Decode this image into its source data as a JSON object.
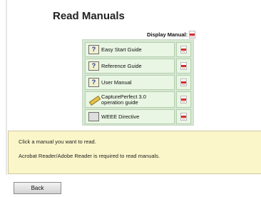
{
  "page": {
    "title": "Read Manuals"
  },
  "display_manual": {
    "label": "Display Manual:",
    "icon": "pdf-icon"
  },
  "manuals": [
    {
      "label": "Easy Start Guide",
      "icon": "book-help-icon"
    },
    {
      "label": "Reference Guide",
      "icon": "book-help-icon"
    },
    {
      "label": "User Manual",
      "icon": "book-help-icon"
    },
    {
      "label_line1": "CapturePerfect 3.0",
      "label_line2": "operation guide",
      "icon": "pencil-icon"
    },
    {
      "label": "WEEE Directive",
      "icon": "book-icon"
    }
  ],
  "note": {
    "line1": "Click a manual you want to read.",
    "line2": "Acrobat Reader/Adobe Reader is required to read manuals."
  },
  "back_button": {
    "label": "Back"
  },
  "colors": {
    "table_bg": "#d6e7d2",
    "cell_bg": "#e9f6e3",
    "note_bg": "#fbf6c9",
    "pdf_red": "#d42b2b"
  }
}
